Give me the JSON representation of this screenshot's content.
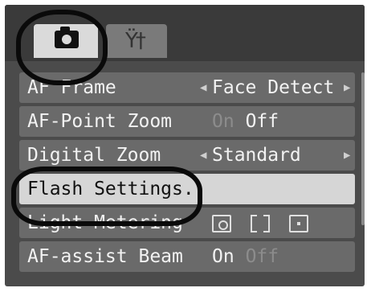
{
  "menu": {
    "rows": [
      {
        "label": "AF Frame",
        "value": "Face Detect"
      },
      {
        "label": "AF-Point Zoom",
        "value_on": "On",
        "value_off": "Off"
      },
      {
        "label": "Digital Zoom",
        "value": "Standard"
      },
      {
        "label": "Flash Settings..",
        "value": ""
      },
      {
        "label": "Light Metering",
        "value": ""
      },
      {
        "label": "AF-assist Beam",
        "value_on": "On",
        "value_off": "Off"
      }
    ]
  },
  "icons": {
    "camera_tab": "camera-icon",
    "setup_tab": "tools-icon",
    "metering": [
      "evaluative-metering-icon",
      "center-weighted-metering-icon",
      "spot-metering-icon"
    ]
  },
  "glyphs": {
    "left_arrow": "◀",
    "right_arrow": "▶",
    "tools": "Ϋ†"
  },
  "colors": {
    "screen_bg": "#4b4b4b",
    "row_bg": "#6a6a6a",
    "selected_row_bg": "#d6d6d6",
    "text": "#f2f2f2",
    "dim_text": "#8c8c8c"
  }
}
